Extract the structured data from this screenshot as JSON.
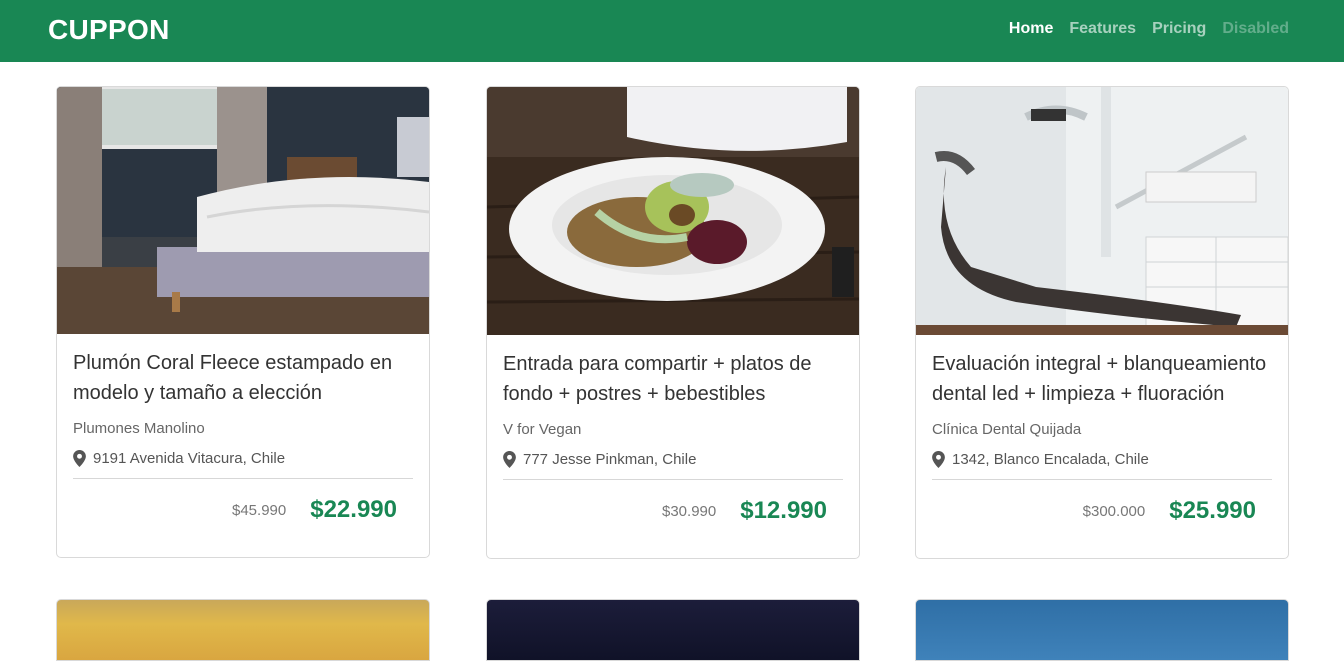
{
  "navbar": {
    "brand": "CUPPON",
    "links": [
      {
        "label": "Home",
        "state": "active"
      },
      {
        "label": "Features",
        "state": "normal"
      },
      {
        "label": "Pricing",
        "state": "normal"
      },
      {
        "label": "Disabled",
        "state": "disabled"
      }
    ]
  },
  "colors": {
    "brand_green": "#198754",
    "price_green": "#198754"
  },
  "cards": [
    {
      "title": "Plumón Coral Fleece estampado en modelo y tamaño a elección",
      "merchant": "Plumones Manolino",
      "location": "9191 Avenida Vitacura, Chile",
      "old_price": "$45.990",
      "price": "$22.990",
      "image": "bedroom-photo"
    },
    {
      "title": "Entrada para compartir + platos de fondo + postres + bebestibles",
      "merchant": "V for Vegan",
      "location": "777 Jesse Pinkman, Chile",
      "old_price": "$30.990",
      "price": "$12.990",
      "image": "vegan-dish-photo"
    },
    {
      "title": "Evaluación integral + blanqueamiento dental led + limpieza + fluoración",
      "merchant": "Clínica Dental Quijada",
      "location": "1342, Blanco Encalada, Chile",
      "old_price": "$300.000",
      "price": "$25.990",
      "image": "dental-chair-photo"
    }
  ],
  "location_icon": "map-marker-icon"
}
